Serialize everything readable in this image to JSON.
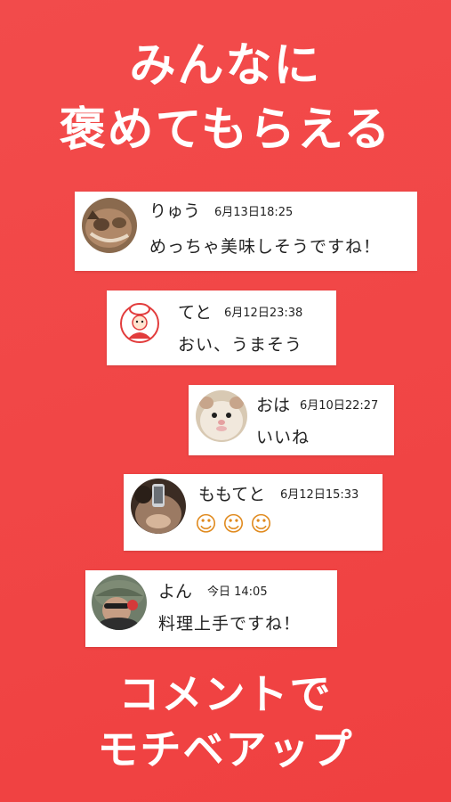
{
  "headline_top": {
    "line1": "みんなに",
    "line2": "褒めてもらえる"
  },
  "headline_bottom": {
    "line1": "コメントで",
    "line2": "モチベアップ"
  },
  "comments": [
    {
      "name": "りゅう",
      "time": "6月13日18:25",
      "text": "めっちゃ美味しそうですね！",
      "avatar": "cat-photo"
    },
    {
      "name": "てと",
      "time": "6月12日23:38",
      "text": "おい、うまそう",
      "avatar": "chef-illustration"
    },
    {
      "name": "おは",
      "time": "6月10日22:27",
      "text": "いいね",
      "avatar": "hamster-photo"
    },
    {
      "name": "ももてと",
      "time": "6月12日15:33",
      "text": "☺☺☺",
      "avatar": "person-selfie-photo"
    },
    {
      "name": "よん",
      "time": "今日 14:05",
      "text": "料理上手ですね！",
      "avatar": "person-hat-photo"
    }
  ],
  "colors": {
    "background": "#f24b4b",
    "card": "#ffffff",
    "text": "#222222"
  }
}
